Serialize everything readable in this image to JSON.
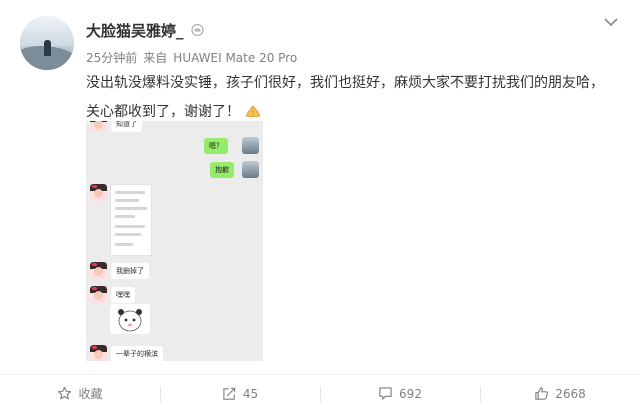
{
  "post": {
    "username": "大脸猫吴雅婷_",
    "time": "25分钟前",
    "source_prefix": "来自",
    "device": "HUAWEI Mate 20 Pro",
    "text": "没出轨没爆料没实锤，孩子们很好，我们也挺好，麻烦大家不要打扰我们的朋友哈，关心都收到了，谢谢了！",
    "emoji": "pray-icon"
  },
  "chat_image": {
    "messages": [
      {
        "side": "left",
        "text": "知道了"
      },
      {
        "side": "right",
        "text": "嗯？"
      },
      {
        "side": "right",
        "text": "抱歉"
      },
      {
        "side": "left",
        "kind": "screenshot"
      },
      {
        "side": "left",
        "text": "我删掉了"
      },
      {
        "side": "left",
        "text": "嘿嘿"
      },
      {
        "side": "left",
        "kind": "sticker"
      },
      {
        "side": "left",
        "text": "一辈子的横滨"
      }
    ]
  },
  "toolbar": {
    "favorite_label": "收藏",
    "repost_count": "45",
    "comment_count": "692",
    "like_count": "2668"
  },
  "colors": {
    "text": "#333333",
    "meta": "#808080",
    "wechat_green": "#95ec69",
    "chat_bg": "#ececec"
  }
}
